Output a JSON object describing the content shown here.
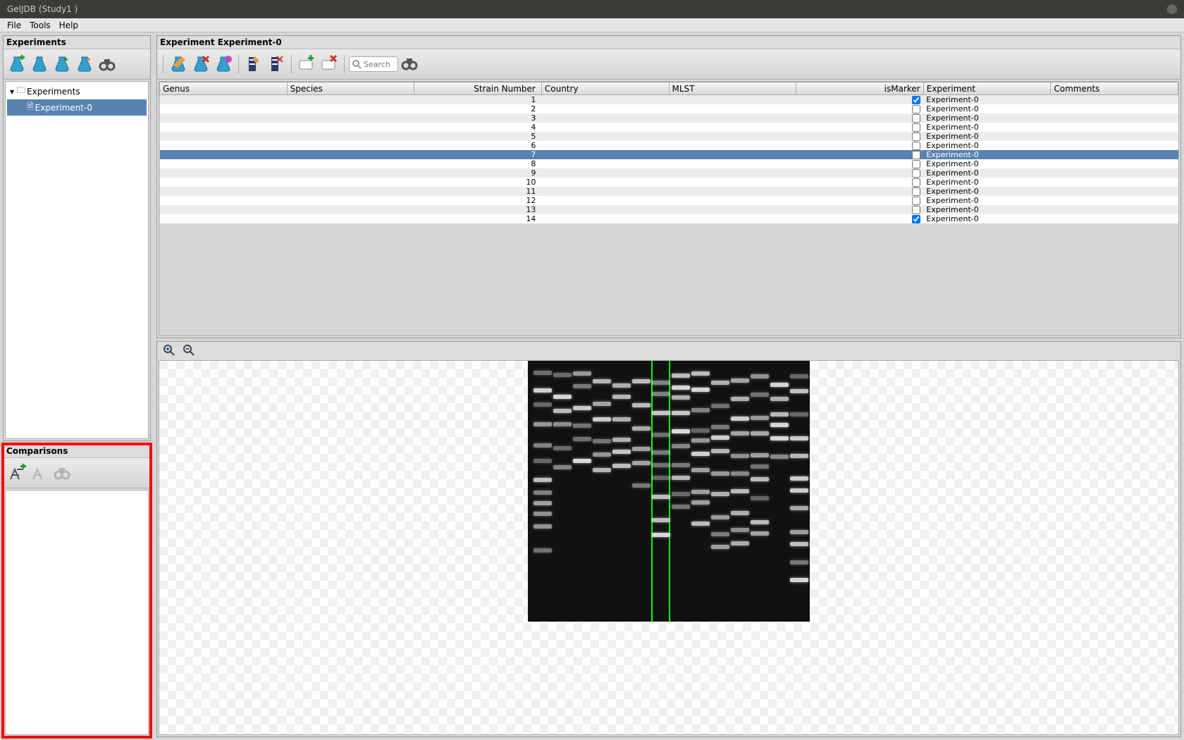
{
  "window": {
    "title": "GelJDB (Study1 )"
  },
  "menu": {
    "file": "File",
    "tools": "Tools",
    "help": "Help"
  },
  "left": {
    "experiments": {
      "title": "Experiments",
      "root": "Experiments",
      "items": [
        "Experiment-0"
      ]
    },
    "comparisons": {
      "title": "Comparisons"
    }
  },
  "experiment": {
    "title": "Experiment Experiment-0",
    "search_placeholder": "Search",
    "columns": [
      "Genus",
      "Species",
      "Strain Number",
      "Country",
      "MLST",
      "isMarker",
      "Experiment",
      "Comments"
    ],
    "rows": [
      {
        "strain": "1",
        "marker": true,
        "exp": "Experiment-0",
        "selected": false
      },
      {
        "strain": "2",
        "marker": false,
        "exp": "Experiment-0",
        "selected": false
      },
      {
        "strain": "3",
        "marker": false,
        "exp": "Experiment-0",
        "selected": false
      },
      {
        "strain": "4",
        "marker": false,
        "exp": "Experiment-0",
        "selected": false
      },
      {
        "strain": "5",
        "marker": false,
        "exp": "Experiment-0",
        "selected": false
      },
      {
        "strain": "6",
        "marker": false,
        "exp": "Experiment-0",
        "selected": false
      },
      {
        "strain": "7",
        "marker": false,
        "exp": "Experiment-0",
        "selected": true
      },
      {
        "strain": "8",
        "marker": false,
        "exp": "Experiment-0",
        "selected": false
      },
      {
        "strain": "9",
        "marker": false,
        "exp": "Experiment-0",
        "selected": false
      },
      {
        "strain": "10",
        "marker": false,
        "exp": "Experiment-0",
        "selected": false
      },
      {
        "strain": "11",
        "marker": false,
        "exp": "Experiment-0",
        "selected": false
      },
      {
        "strain": "12",
        "marker": false,
        "exp": "Experiment-0",
        "selected": false
      },
      {
        "strain": "13",
        "marker": false,
        "exp": "Experiment-0",
        "selected": false
      },
      {
        "strain": "14",
        "marker": true,
        "exp": "Experiment-0",
        "selected": false
      }
    ]
  }
}
